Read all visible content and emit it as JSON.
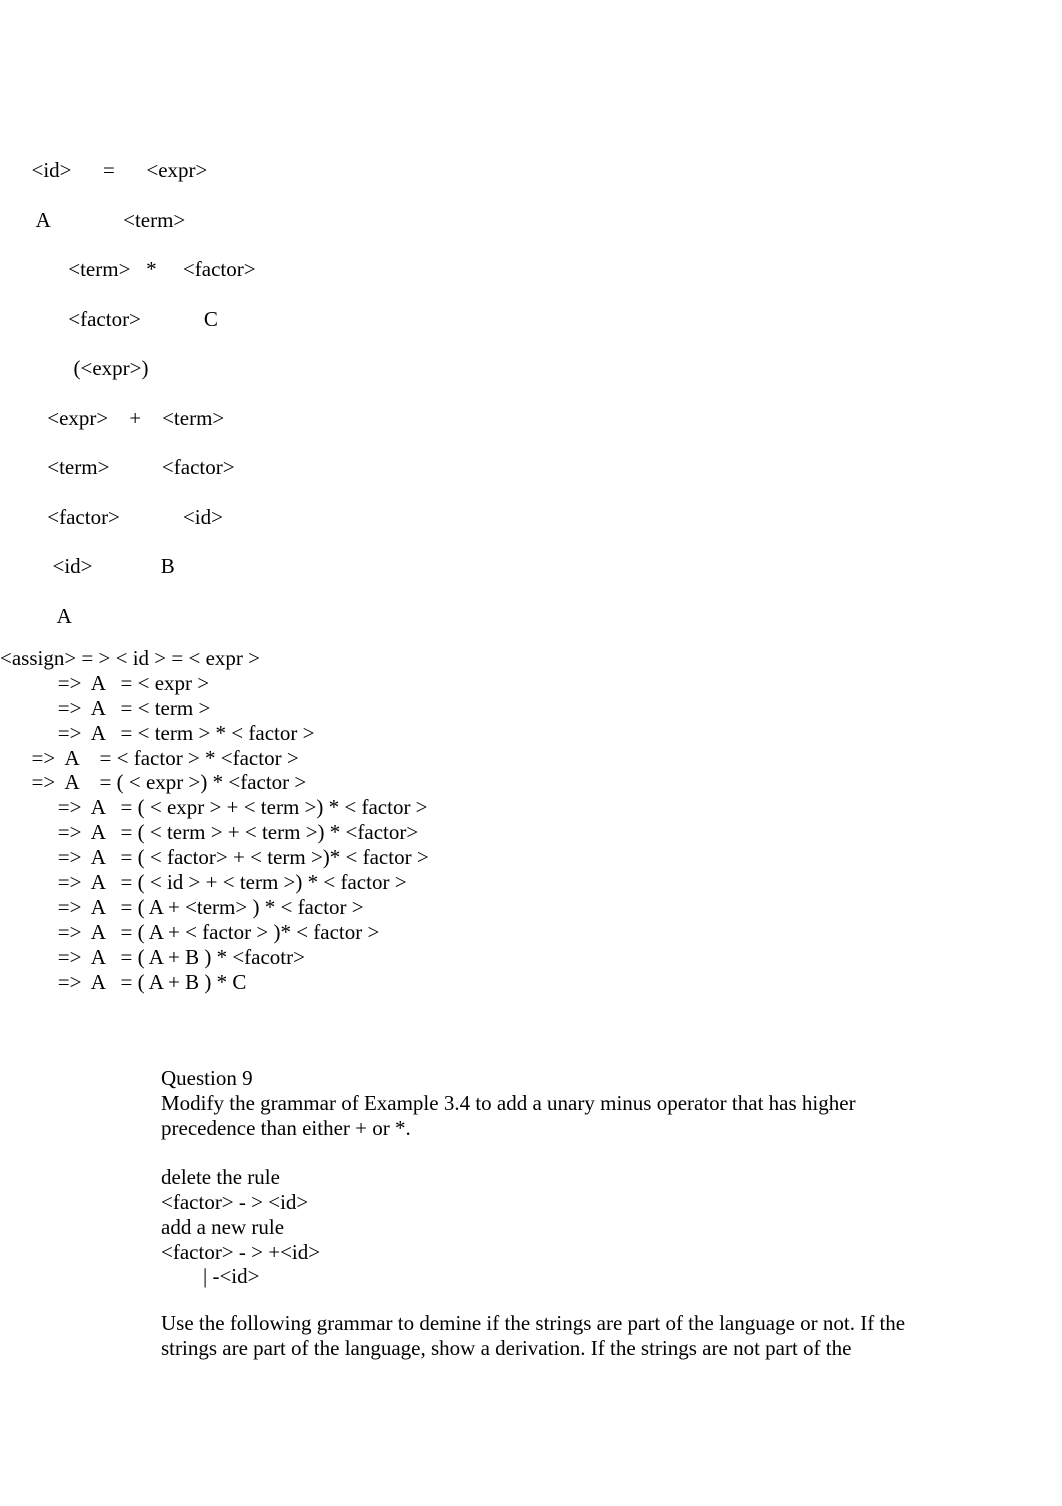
{
  "document": {
    "page_background": "#ffffff",
    "text_color": "#000000"
  },
  "parse_tree": {
    "caption": "parse-tree-derivation-diagram",
    "lines": [
      "      <id>      =      <expr>",
      "       A              <term>",
      "             <term>   *     <factor>",
      "             <factor>            C",
      "              (<expr>)",
      "         <expr>    +    <term>",
      "         <term>          <factor>",
      "         <factor>            <id>",
      "          <id>             B",
      "           A"
    ]
  },
  "derivation": {
    "caption": "leftmost-derivation-sequence",
    "lines": [
      "<assign> = > < id > = < expr >",
      "           =>  A   = < expr >",
      "           =>  A   = < term >",
      "           =>  A   = < term > * < factor >",
      "      =>  A    = < factor > * <factor >",
      "      =>  A    = ( < expr >) * <factor >",
      "           =>  A   = ( < expr > + < term >) * < factor >",
      "           =>  A   = ( < term > + < term >) * <factor>",
      "           =>  A   = ( < factor> + < term >)* < factor >",
      "           =>  A   = ( < id > + < term >) * < factor >",
      "           =>  A   = ( A + <term> ) * < factor >",
      "           =>  A   = ( A + < factor > )* < factor >",
      "           =>  A   = ( A + B ) * <facotr>",
      "           =>  A   = ( A + B ) * C"
    ]
  },
  "question9": {
    "heading": "Question 9",
    "prompt": "Modify the grammar of Example 3.4 to add a unary minus operator that has higher precedence than either + or *.",
    "answer_lines": [
      "delete the rule",
      "<factor> - > <id>",
      "add a new rule",
      "<factor> - > +<id>",
      "        | -<id>"
    ]
  },
  "closing": {
    "paragraph": "Use the following grammar to demine if the strings are part of the language or not. If the strings are part of the language, show a derivation. If the strings are not part of the"
  }
}
